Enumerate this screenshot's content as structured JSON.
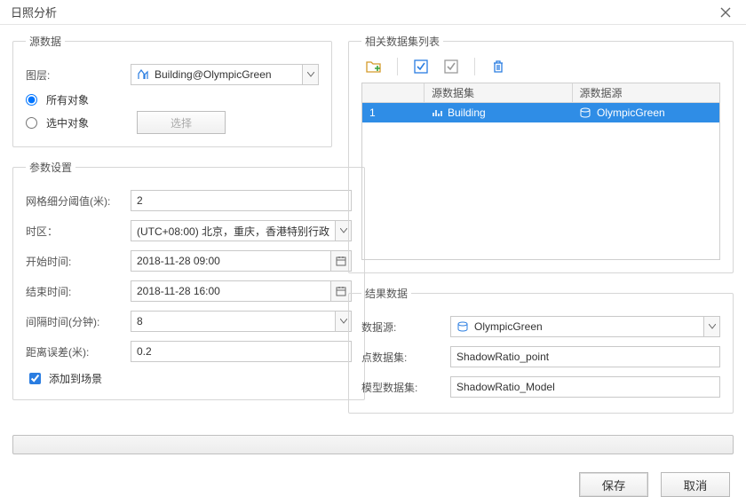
{
  "titlebar": {
    "title": "日照分析"
  },
  "sourceData": {
    "legend": "源数据",
    "layerLabel": "图层:",
    "layerValue": "Building@OlympicGreen",
    "allObjects": "所有对象",
    "selectedObjects": "选中对象",
    "selectBtn": "选择"
  },
  "params": {
    "legend": "参数设置",
    "gridLabel": "网格细分阈值(米):",
    "gridValue": "2",
    "tzLabel": "时区：",
    "tzValue": "(UTC+08:00) 北京，重庆，香港特别行政",
    "startLabel": "开始时间:",
    "startValue": "2018-11-28 09:00",
    "endLabel": "结束时间:",
    "endValue": "2018-11-28 16:00",
    "intervalLabel": "间隔时间(分钟):",
    "intervalValue": "8",
    "distLabel": "距离误差(米):",
    "distValue": "0.2",
    "addToScene": "添加到场景"
  },
  "relatedList": {
    "legend": "相关数据集列表",
    "col0": "",
    "col1": "源数据集",
    "col2": "源数据源",
    "rows": [
      {
        "idx": "1",
        "dataset": "Building",
        "datasource": "OlympicGreen",
        "selected": true
      }
    ]
  },
  "result": {
    "legend": "结果数据",
    "datasourceLabel": "数据源:",
    "datasourceValue": "OlympicGreen",
    "pointLabel": "点数据集:",
    "pointValue": "ShadowRatio_point",
    "modelLabel": "模型数据集:",
    "modelValue": "ShadowRatio_Model"
  },
  "footer": {
    "save": "保存",
    "cancel": "取消"
  }
}
